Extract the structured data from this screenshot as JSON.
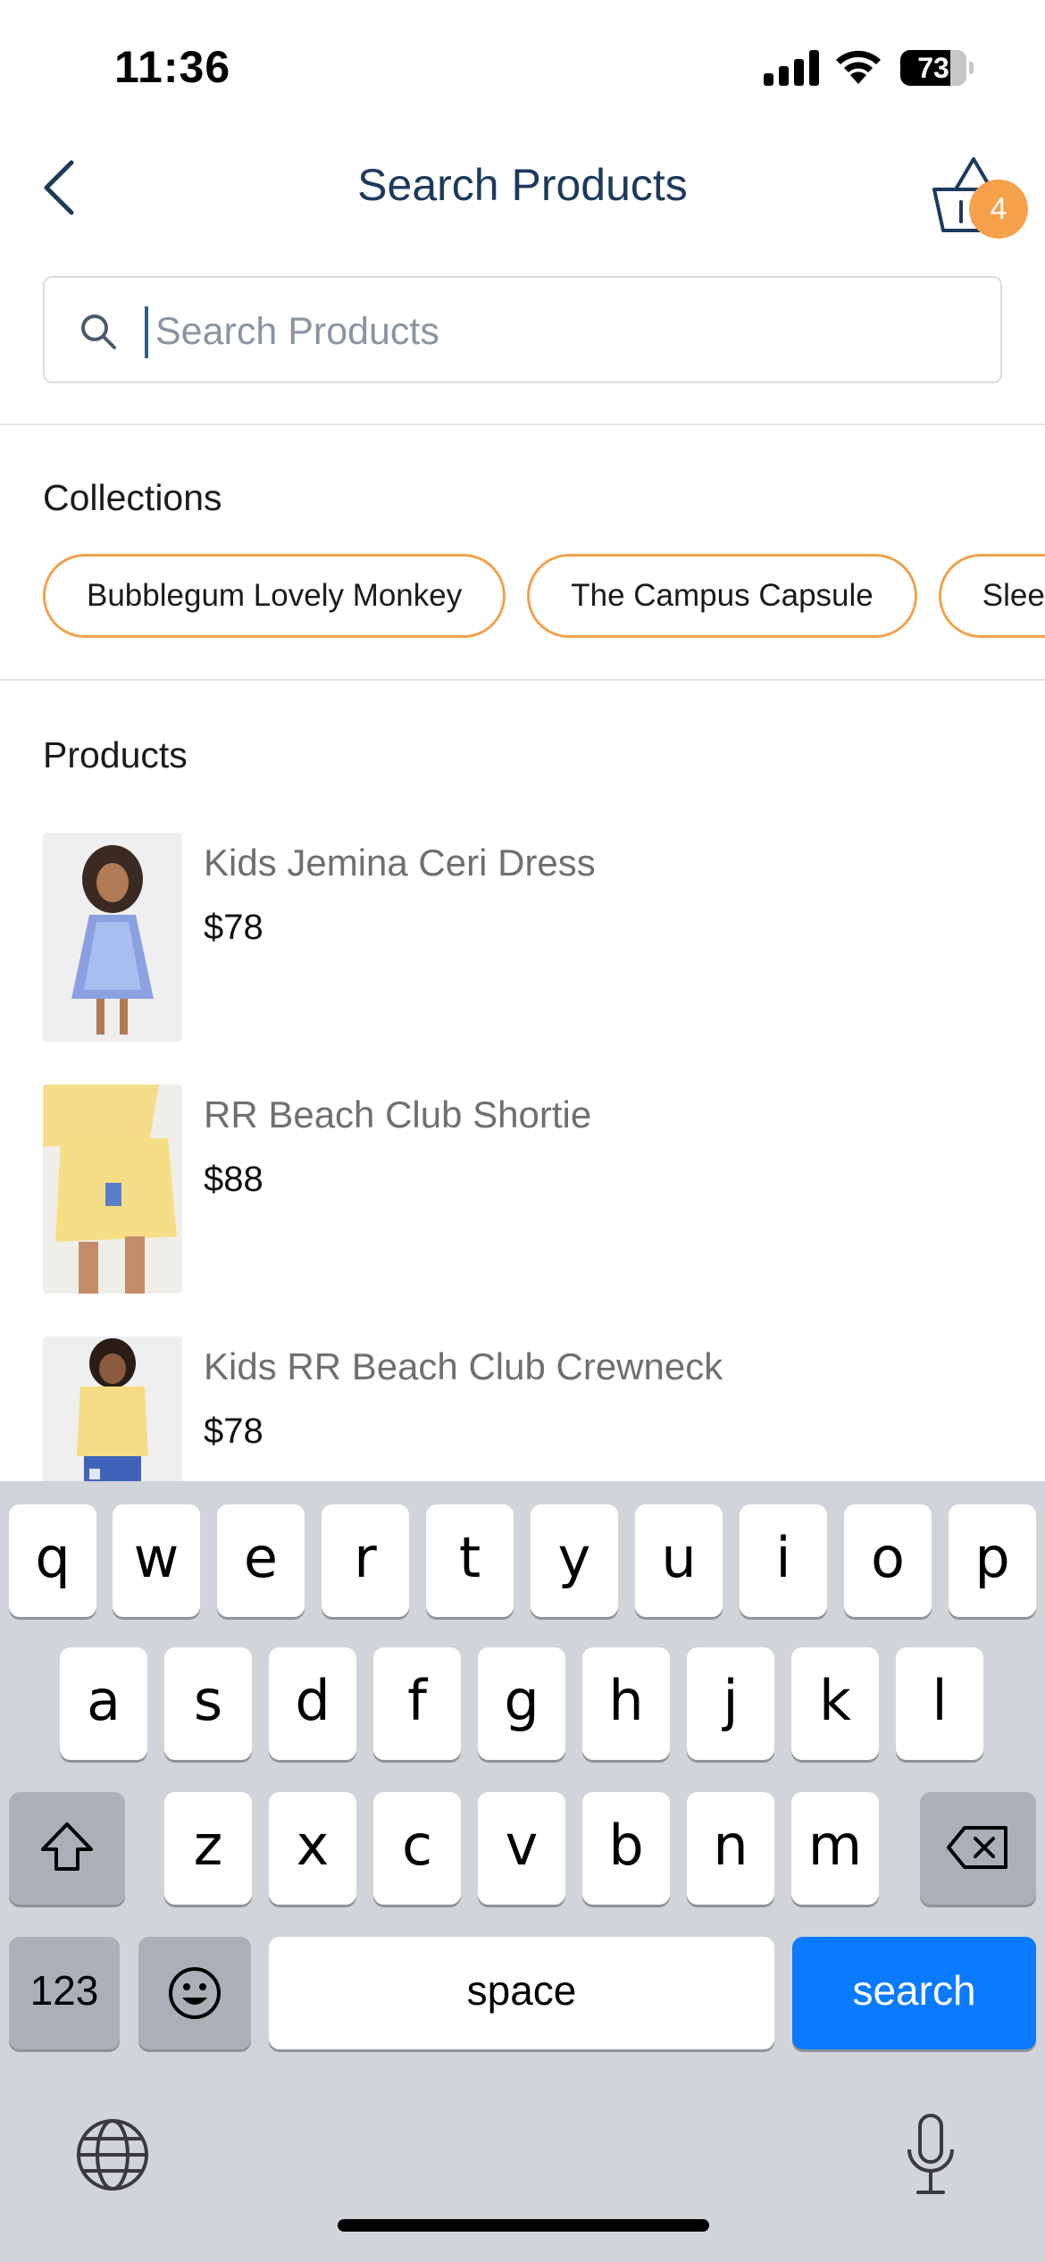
{
  "status_bar": {
    "time": "11:36",
    "battery": "73"
  },
  "header": {
    "title": "Search Products",
    "cart_count": "4"
  },
  "search": {
    "placeholder": "Search Products",
    "value": ""
  },
  "collections": {
    "heading": "Collections",
    "items": [
      "Bubblegum Lovely Monkey",
      "The Campus Capsule",
      "Slee"
    ]
  },
  "products": {
    "heading": "Products",
    "items": [
      {
        "name": "Kids Jemina Ceri Dress",
        "price": "$78"
      },
      {
        "name": "RR Beach Club Shortie",
        "price": "$88"
      },
      {
        "name": "Kids RR Beach Club Crewneck",
        "price": "$78"
      }
    ]
  },
  "keyboard": {
    "row1": [
      "q",
      "w",
      "e",
      "r",
      "t",
      "y",
      "u",
      "i",
      "o",
      "p"
    ],
    "row2": [
      "a",
      "s",
      "d",
      "f",
      "g",
      "h",
      "j",
      "k",
      "l"
    ],
    "row3": [
      "z",
      "x",
      "c",
      "v",
      "b",
      "n",
      "m"
    ],
    "numbers_label": "123",
    "space_label": "space",
    "search_label": "search"
  },
  "colors": {
    "accent": "#f1a14f",
    "title": "#1d3a5c",
    "search_key": "#0a7bff",
    "badge": "#f5a04a"
  }
}
